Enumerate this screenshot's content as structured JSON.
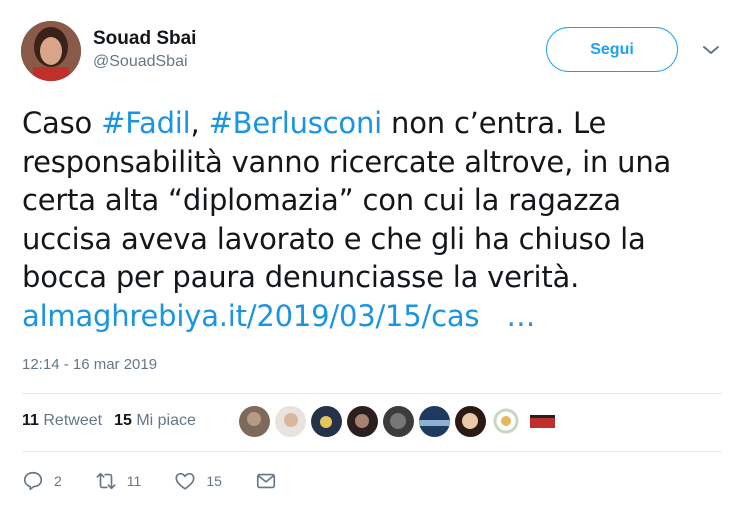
{
  "author": {
    "name": "Souad Sbai",
    "handle": "@SouadSbai"
  },
  "follow_button": {
    "label": "Segui"
  },
  "tweet": {
    "lines": [
      {
        "pre": "Caso ",
        "tag1": "#Fadil",
        "mid": ", ",
        "tag2": "#Berlusconi",
        "post": " non c’entra. Le"
      },
      "responsabilità vanno ricercate altrove, in una",
      "certa alta “diplomazia” con cui la ragazza",
      "uccisa aveva lavorato e che gli ha chiuso la",
      "bocca per paura denunciasse la verità."
    ],
    "link": "almaghrebiya.it/2019/03/15/cas   …"
  },
  "timestamp": "12:14 - 16 mar 2019",
  "stats": {
    "retweets_count": "11",
    "retweets_label": "Retweet",
    "likes_count": "15",
    "likes_label": "Mi piace"
  },
  "likers": [
    "liker-1",
    "liker-2",
    "liker-3",
    "liker-4",
    "liker-5",
    "liker-6",
    "liker-7",
    "liker-8",
    "liker-9"
  ],
  "actions": {
    "replies": "2",
    "retweets": "11",
    "likes": "15"
  },
  "colors": {
    "accent": "#1da1f2",
    "link": "#1b95e0",
    "muted": "#657786",
    "text": "#14171a"
  }
}
